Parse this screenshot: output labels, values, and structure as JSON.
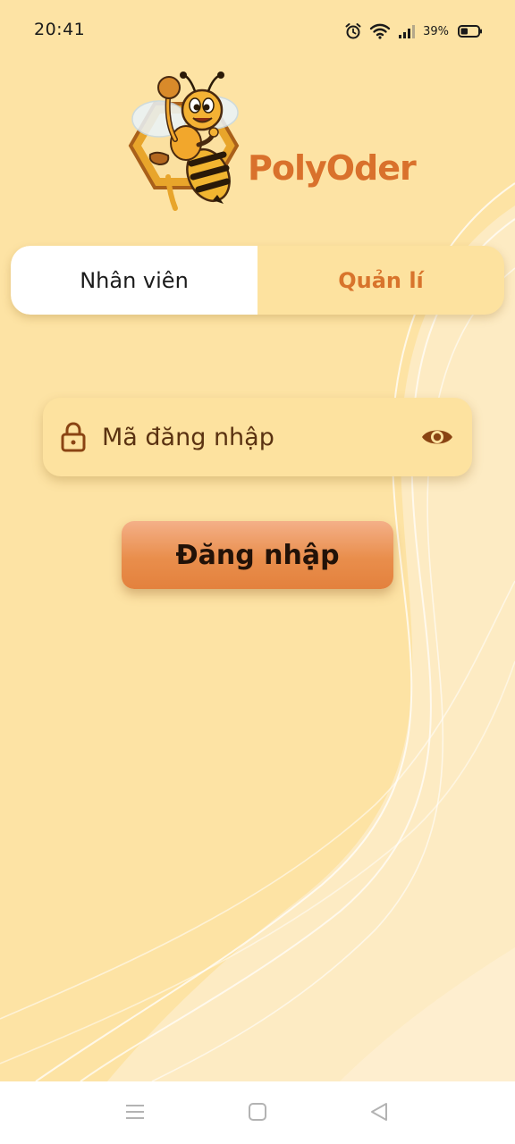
{
  "status_bar": {
    "time": "20:41",
    "battery_percent": "39%",
    "icons": [
      "alarm-icon",
      "wifi-icon",
      "signal-icon",
      "battery-icon"
    ]
  },
  "brand": {
    "name": "PolyOder",
    "logo": "bee-mascot-logo",
    "accent_color": "#d9712c"
  },
  "role_tabs": {
    "items": [
      {
        "label": "Nhân viên",
        "active": true
      },
      {
        "label": "Quản lí",
        "active": false
      }
    ]
  },
  "login_form": {
    "code_field": {
      "placeholder": "Mã đăng nhập",
      "value": "",
      "icon": "lock-icon",
      "toggle_icon": "eye-icon"
    },
    "submit_label": "Đăng nhập"
  },
  "nav_bar": {
    "buttons": [
      "menu-icon",
      "home-icon",
      "back-icon"
    ]
  },
  "colors": {
    "background": "#fde3a4",
    "button": "#e98e4c",
    "icon_brown": "#8a4413"
  }
}
